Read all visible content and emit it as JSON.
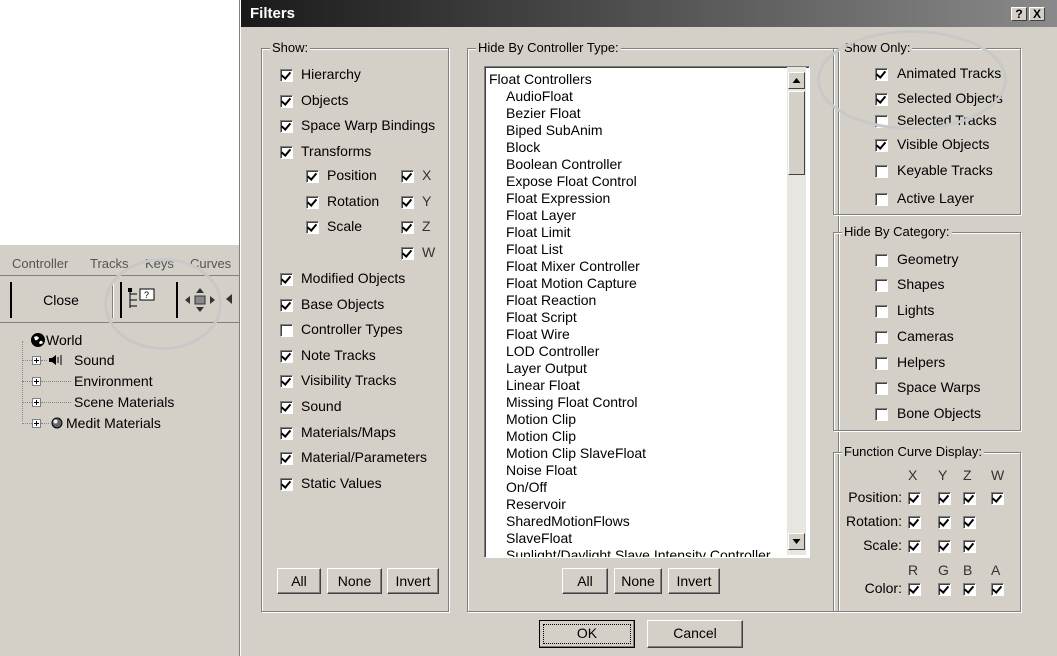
{
  "background_window": {
    "menu": [
      "Controller",
      "Tracks",
      "Keys",
      "Curves"
    ],
    "close_label": "Close",
    "tree": [
      {
        "label": "World",
        "icon": "globe-icon"
      },
      {
        "label": "Sound",
        "icon": "speaker-icon"
      },
      {
        "label": "Environment",
        "icon": ""
      },
      {
        "label": "Scene Materials",
        "icon": ""
      },
      {
        "label": "Medit Materials",
        "icon": "material-sphere-icon"
      }
    ]
  },
  "dialog": {
    "title": "Filters",
    "help_label": "?",
    "close_label": "X",
    "show": {
      "title": "Show:",
      "items": [
        {
          "label": "Hierarchy",
          "checked": true
        },
        {
          "label": "Objects",
          "checked": true
        },
        {
          "label": "Space Warp Bindings",
          "checked": true
        },
        {
          "label": "Transforms",
          "checked": true
        }
      ],
      "transforms": [
        {
          "label": "Position",
          "checked": true
        },
        {
          "label": "Rotation",
          "checked": true
        },
        {
          "label": "Scale",
          "checked": true
        }
      ],
      "axes": [
        {
          "label": "X",
          "checked": true
        },
        {
          "label": "Y",
          "checked": true
        },
        {
          "label": "Z",
          "checked": true
        },
        {
          "label": "W",
          "checked": true
        }
      ],
      "items2": [
        {
          "label": "Modified Objects",
          "checked": true
        },
        {
          "label": "Base Objects",
          "checked": true
        },
        {
          "label": "Controller Types",
          "checked": false
        },
        {
          "label": "Note Tracks",
          "checked": true
        },
        {
          "label": "Visibility Tracks",
          "checked": true
        },
        {
          "label": "Sound",
          "checked": true
        },
        {
          "label": "Materials/Maps",
          "checked": true
        },
        {
          "label": "Material/Parameters",
          "checked": true
        },
        {
          "label": "Static Values",
          "checked": true
        }
      ],
      "buttons": [
        "All",
        "None",
        "Invert"
      ]
    },
    "hide_by_controller": {
      "title": "Hide By Controller Type:",
      "header_item": "Float Controllers",
      "items": [
        "AudioFloat",
        "Bezier Float",
        "Biped SubAnim",
        "Block",
        "Boolean Controller",
        "Expose Float Control",
        "Float Expression",
        "Float Layer",
        "Float Limit",
        "Float List",
        "Float Mixer Controller",
        "Float Motion Capture",
        "Float Reaction",
        "Float Script",
        "Float Wire",
        "LOD Controller",
        "Layer Output",
        "Linear Float",
        "Missing Float Control",
        "Motion Clip",
        "Motion Clip",
        "Motion Clip SlaveFloat",
        "Noise Float",
        "On/Off",
        "Reservoir",
        "SharedMotionFlows",
        "SlaveFloat",
        "Sunlight/Daylight Slave Intensity Controller"
      ],
      "buttons": [
        "All",
        "None",
        "Invert"
      ]
    },
    "show_only": {
      "title": "Show Only:",
      "items": [
        {
          "label": "Animated Tracks",
          "checked": true
        },
        {
          "label": "Selected Objects",
          "checked": true
        },
        {
          "label": "Selected Tracks",
          "checked": false
        },
        {
          "label": "Visible Objects",
          "checked": true
        },
        {
          "label": "Keyable Tracks",
          "checked": false
        },
        {
          "label": "Active Layer",
          "checked": false
        }
      ]
    },
    "hide_by_category": {
      "title": "Hide By Category:",
      "items": [
        {
          "label": "Geometry",
          "checked": false
        },
        {
          "label": "Shapes",
          "checked": false
        },
        {
          "label": "Lights",
          "checked": false
        },
        {
          "label": "Cameras",
          "checked": false
        },
        {
          "label": "Helpers",
          "checked": false
        },
        {
          "label": "Space Warps",
          "checked": false
        },
        {
          "label": "Bone Objects",
          "checked": false
        }
      ]
    },
    "function_curve": {
      "title": "Function Curve Display:",
      "axis_headers": [
        "X",
        "Y",
        "Z",
        "W"
      ],
      "rows": [
        {
          "label": "Position:",
          "checks": [
            true,
            true,
            true,
            true
          ]
        },
        {
          "label": "Rotation:",
          "checks": [
            true,
            true,
            true
          ]
        },
        {
          "label": "Scale:",
          "checks": [
            true,
            true,
            true
          ]
        }
      ],
      "color_headers": [
        "R",
        "G",
        "B",
        "A"
      ],
      "color_row": {
        "label": "Color:",
        "checks": [
          true,
          true,
          true,
          true
        ]
      }
    },
    "ok_label": "OK",
    "cancel_label": "Cancel"
  },
  "colors": {
    "dialog_face": "#d4d0c8",
    "highlight_circle": "#c8c8c8"
  }
}
